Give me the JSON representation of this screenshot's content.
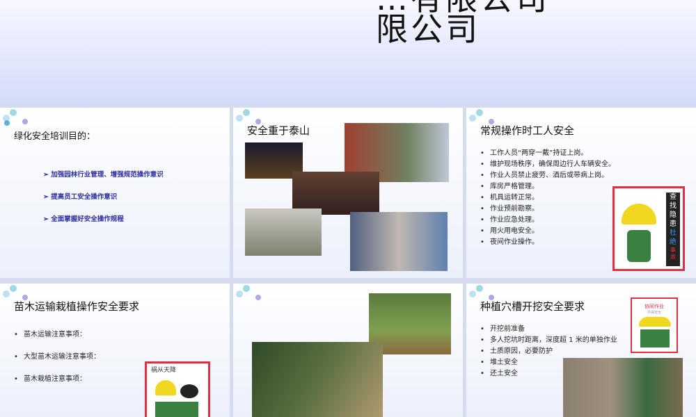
{
  "banner": {
    "title_line1": "…有限公司",
    "title_line2": "限公司"
  },
  "slides": [
    {
      "title": "绿化安全培训目的：",
      "items": [
        "加强园林行业管理、增强规范操作意识",
        "提高员工安全操作意识",
        "全面掌握好安全操作规程"
      ]
    },
    {
      "title": "安全重于泰山"
    },
    {
      "title": "常规操作时工人安全",
      "items": [
        "工作人员“两穿一戴”持证上岗。",
        "维护现场秩序，确保周边行人车辆安全。",
        "作业人员禁止疲劳、酒后或带病上岗。",
        "库房严格管理。",
        "机具运转正常。",
        "作业预前勘察。",
        "作业应急处理。",
        "用火用电安全。",
        "夜间作业操作。"
      ],
      "sign": [
        "查",
        "找",
        "隐",
        "患",
        "杜",
        "绝",
        "事",
        "故"
      ]
    },
    {
      "title": "苗木运输栽植操作安全要求",
      "items": [
        "苗木运输注意事项：",
        "大型苗木运输注意事项：",
        "苗木栽植注意事项："
      ],
      "sign": "祸从天降"
    },
    {
      "title": ""
    },
    {
      "title": "种植穴槽开挖安全要求",
      "items": [
        "开挖前准备",
        "多人挖坑时距离，深度超 1 米的单独作业",
        "土质原因，必要防护",
        "堆土安全",
        "还土安全"
      ],
      "sign": "协同作业",
      "sign_sub": "共保安全"
    }
  ]
}
